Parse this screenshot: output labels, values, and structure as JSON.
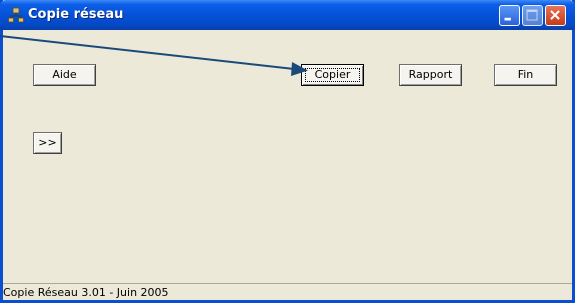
{
  "window": {
    "title": "Copie réseau"
  },
  "buttons": {
    "aide": "Aide",
    "copier": "Copier",
    "rapport": "Rapport",
    "fin": "Fin",
    "expand": ">>"
  },
  "status": {
    "text": "Copie Réseau 3.01 - Juin 2005"
  },
  "colors": {
    "titlebar": "#0552d8",
    "window_bg": "#ece9d8",
    "annotation_arrow": "#1a4a7a"
  },
  "icons": [
    "network-app-icon",
    "minimize-icon",
    "maximize-icon",
    "close-icon"
  ]
}
